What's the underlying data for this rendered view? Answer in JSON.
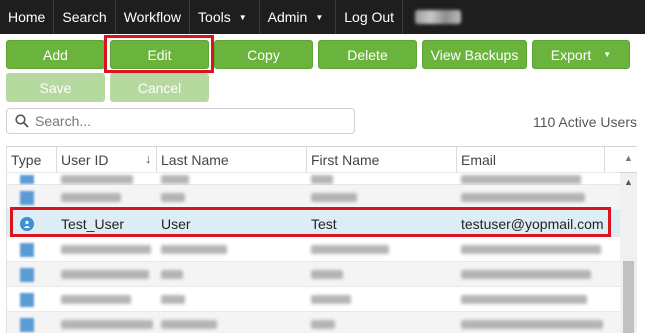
{
  "nav": {
    "items": [
      {
        "label": "Home"
      },
      {
        "label": "Search"
      },
      {
        "label": "Workflow"
      },
      {
        "label": "Tools",
        "dropdown": true
      },
      {
        "label": "Admin",
        "dropdown": true
      },
      {
        "label": "Log Out"
      }
    ]
  },
  "toolbar": {
    "add_label": "Add",
    "edit_label": "Edit",
    "copy_label": "Copy",
    "delete_label": "Delete",
    "view_backups_label": "View Backups",
    "export_label": "Export",
    "save_label": "Save",
    "cancel_label": "Cancel"
  },
  "search": {
    "placeholder": "Search...",
    "active_users": "110 Active Users"
  },
  "grid": {
    "headers": {
      "type": "Type",
      "user_id": "User ID",
      "last_name": "Last Name",
      "first_name": "First Name",
      "email": "Email"
    },
    "selected_row": {
      "user_id": "Test_User",
      "last_name": "User",
      "first_name": "Test",
      "email": "testuser@yopmail.com"
    }
  },
  "colors": {
    "button_green": "#6ab43e",
    "button_disabled": "#b5d99f",
    "highlight_red": "#d9141e",
    "nav_background": "#1e1e1e",
    "selected_row": "#ddedf6"
  }
}
